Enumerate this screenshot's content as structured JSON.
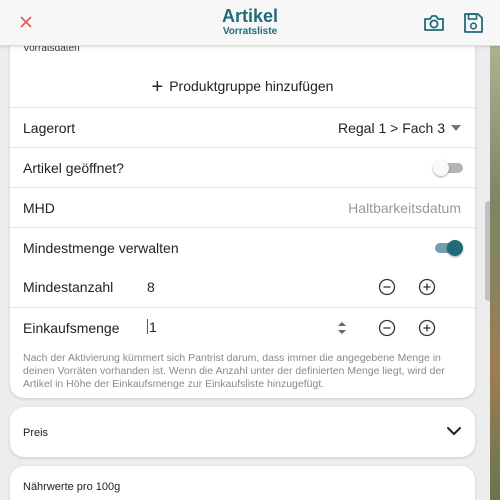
{
  "appbar": {
    "title": "Artikel",
    "subtitle": "Vorratsliste",
    "close_icon": "close-icon",
    "camera_icon": "camera-icon",
    "save_icon": "save-icon"
  },
  "stock": {
    "section_label": "Vorratsdaten",
    "add_group_label": "Produktgruppe hinzufügen",
    "location_label": "Lagerort",
    "location_value": "Regal 1 > Fach 3",
    "opened_label": "Artikel geöffnet?",
    "opened_value": false,
    "mhd_label": "MHD",
    "mhd_placeholder": "Haltbarkeitsdatum",
    "min_manage_label": "Mindestmenge verwalten",
    "min_manage_value": true,
    "min_count_label": "Mindestanzahl",
    "min_count_value": "8",
    "buy_qty_label": "Einkaufsmenge",
    "buy_qty_value": "1",
    "help_text": "Nach der Aktivierung kümmert sich Pantrist darum, dass immer die angegebene Menge in deinen Vorräten vorhanden ist. Wenn die Anzahl unter der definierten Menge liegt, wird der Artikel in Höhe der Einkaufsmenge zur Einkaufsliste hinzugefügt."
  },
  "price_card": {
    "label": "Preis"
  },
  "nutrition_card": {
    "label": "Nährwerte pro 100g"
  },
  "colors": {
    "accent": "#1f6b7a",
    "close": "#e05a5a"
  }
}
